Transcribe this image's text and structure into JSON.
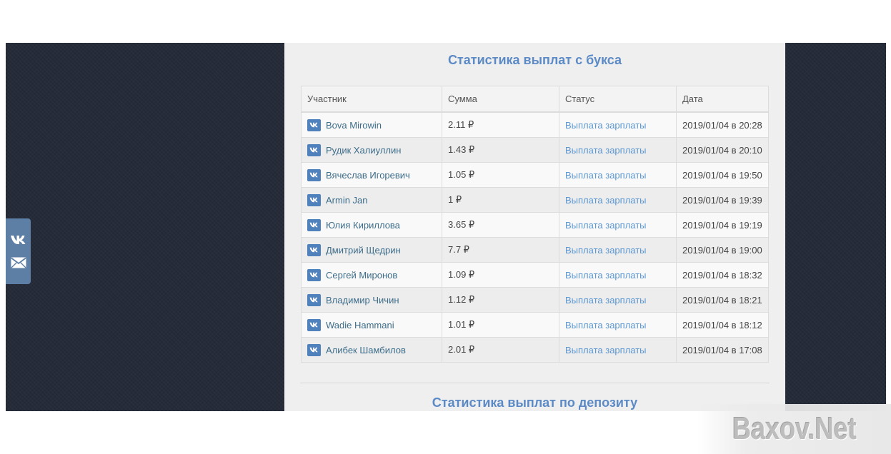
{
  "stats": {
    "title": "Статистика выплат с букса",
    "columns": [
      "Участник",
      "Сумма",
      "Статус",
      "Дата"
    ],
    "rows": [
      {
        "user": "Bova Mirowin",
        "amount": "2.11 ₽",
        "status": "Выплата зарплаты",
        "date": "2019/01/04 в 20:28"
      },
      {
        "user": "Рудик Халиуллин",
        "amount": "1.43 ₽",
        "status": "Выплата зарплаты",
        "date": "2019/01/04 в 20:10"
      },
      {
        "user": "Вячеслав Игоревич",
        "amount": "1.05 ₽",
        "status": "Выплата зарплаты",
        "date": "2019/01/04 в 19:50"
      },
      {
        "user": "Armin Jan",
        "amount": "1 ₽",
        "status": "Выплата зарплаты",
        "date": "2019/01/04 в 19:39"
      },
      {
        "user": "Юлия Кириллова",
        "amount": "3.65 ₽",
        "status": "Выплата зарплаты",
        "date": "2019/01/04 в 19:19"
      },
      {
        "user": "Дмитрий Щедрин",
        "amount": "7.7 ₽",
        "status": "Выплата зарплаты",
        "date": "2019/01/04 в 19:00"
      },
      {
        "user": "Сергей Миронов",
        "amount": "1.09 ₽",
        "status": "Выплата зарплаты",
        "date": "2019/01/04 в 18:32"
      },
      {
        "user": "Владимир Чичин",
        "amount": "1.12 ₽",
        "status": "Выплата зарплаты",
        "date": "2019/01/04 в 18:21"
      },
      {
        "user": "Wadie Hammani",
        "amount": "1.01 ₽",
        "status": "Выплата зарплаты",
        "date": "2019/01/04 в 18:12"
      },
      {
        "user": "Алибек Шамбилов",
        "amount": "2.01 ₽",
        "status": "Выплата зарплаты",
        "date": "2019/01/04 в 17:08"
      }
    ]
  },
  "deposit": {
    "title": "Статистика выплат по депозиту"
  },
  "social": {
    "icons": [
      "vk-icon",
      "mail-icon"
    ]
  },
  "watermark": {
    "text": "Baxov.Net"
  },
  "colors": {
    "background": "#252b38",
    "panel": "#efefef",
    "title": "#5b8ac6",
    "link": "#5b97d1",
    "vk": "#4f81bc",
    "social_bar": "#5d7fa6"
  }
}
